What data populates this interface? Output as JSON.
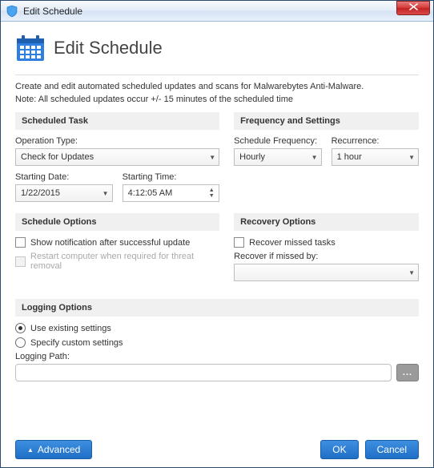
{
  "window": {
    "title": "Edit Schedule"
  },
  "header": {
    "title": "Edit Schedule"
  },
  "intro": "Create and edit automated scheduled updates and scans for Malwarebytes Anti-Malware.",
  "note": "Note: All scheduled updates occur +/- 15 minutes of the scheduled time",
  "sections": {
    "scheduled_task": "Scheduled Task",
    "frequency": "Frequency and Settings",
    "schedule_options": "Schedule Options",
    "recovery_options": "Recovery Options",
    "logging_options": "Logging Options"
  },
  "fields": {
    "operation_type_label": "Operation Type:",
    "operation_type_value": "Check for Updates",
    "starting_date_label": "Starting Date:",
    "starting_date_value": "1/22/2015",
    "starting_time_label": "Starting Time:",
    "starting_time_value": "4:12:05 AM",
    "schedule_frequency_label": "Schedule Frequency:",
    "schedule_frequency_value": "Hourly",
    "recurrence_label": "Recurrence:",
    "recurrence_value": "1 hour",
    "recover_if_missed_label": "Recover if missed by:",
    "recover_if_missed_value": "",
    "logging_path_label": "Logging Path:",
    "logging_path_value": ""
  },
  "checks": {
    "show_notification": "Show notification after successful update",
    "restart_computer": "Restart computer when required for threat removal",
    "recover_missed": "Recover missed tasks"
  },
  "radios": {
    "use_existing": "Use existing settings",
    "specify_custom": "Specify custom settings"
  },
  "buttons": {
    "advanced": "Advanced",
    "ok": "OK",
    "cancel": "Cancel",
    "browse": "..."
  },
  "icons": {
    "app": "shield-icon",
    "calendar": "calendar-icon"
  }
}
